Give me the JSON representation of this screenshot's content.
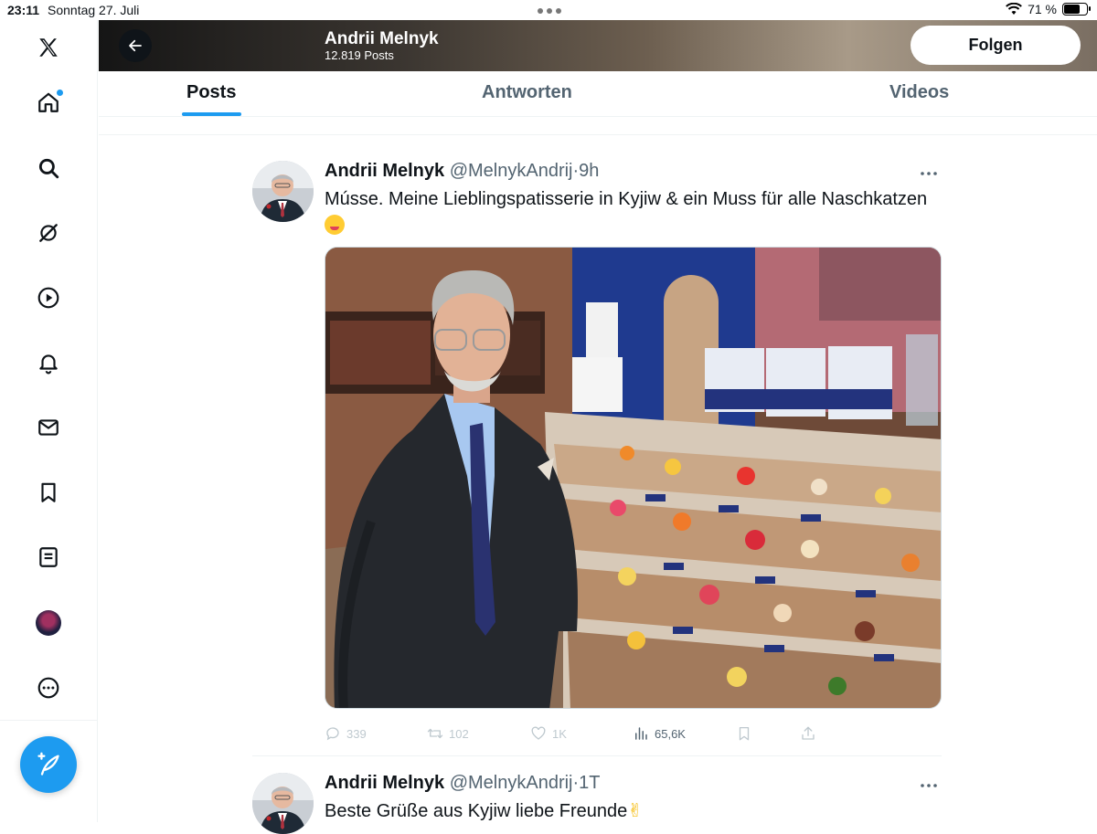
{
  "status_bar": {
    "time": "23:11",
    "date": "Sonntag 27. Juli",
    "battery": "71 %",
    "battery_level": 0.71
  },
  "sidebar": {
    "items": [
      {
        "icon": "x-logo-icon"
      },
      {
        "icon": "home-icon",
        "has_notification_dot": true
      },
      {
        "icon": "search-icon"
      },
      {
        "icon": "grok-icon"
      },
      {
        "icon": "video-play-icon"
      },
      {
        "icon": "bell-icon"
      },
      {
        "icon": "mail-icon"
      },
      {
        "icon": "bookmark-icon"
      },
      {
        "icon": "list-icon"
      },
      {
        "icon": "avatar"
      },
      {
        "icon": "more-circle-icon"
      }
    ],
    "compose_icon": "compose-feather-icon"
  },
  "header": {
    "name": "Andrii Melnyk",
    "posts_count": "12.819 Posts",
    "follow_label": "Folgen"
  },
  "tabs": [
    {
      "label": "Posts",
      "active": true
    },
    {
      "label": "Antworten",
      "active": false
    },
    {
      "label": "Videos",
      "active": false
    }
  ],
  "tweets": [
    {
      "name": "Andrii Melnyk",
      "handle": "@MelnykAndrij",
      "time": "·9h",
      "text": "Músse. Meine Lieblingspatisserie in Kyjiw & ein Muss für alle Naschkatzen",
      "emoji": "yum-face-emoji",
      "actions": {
        "replies": "339",
        "reposts": "102",
        "likes": "1K",
        "views": "65,6K"
      }
    },
    {
      "name": "Andrii Melnyk",
      "handle": "@MelnykAndrij",
      "time": "·1T",
      "text": "Beste Grüße aus Kyjiw liebe Freunde",
      "emoji": "victory-hand-emoji"
    }
  ],
  "colors": {
    "accent": "#1d9bf0",
    "text_primary": "#0f1419",
    "text_secondary": "#536471"
  }
}
